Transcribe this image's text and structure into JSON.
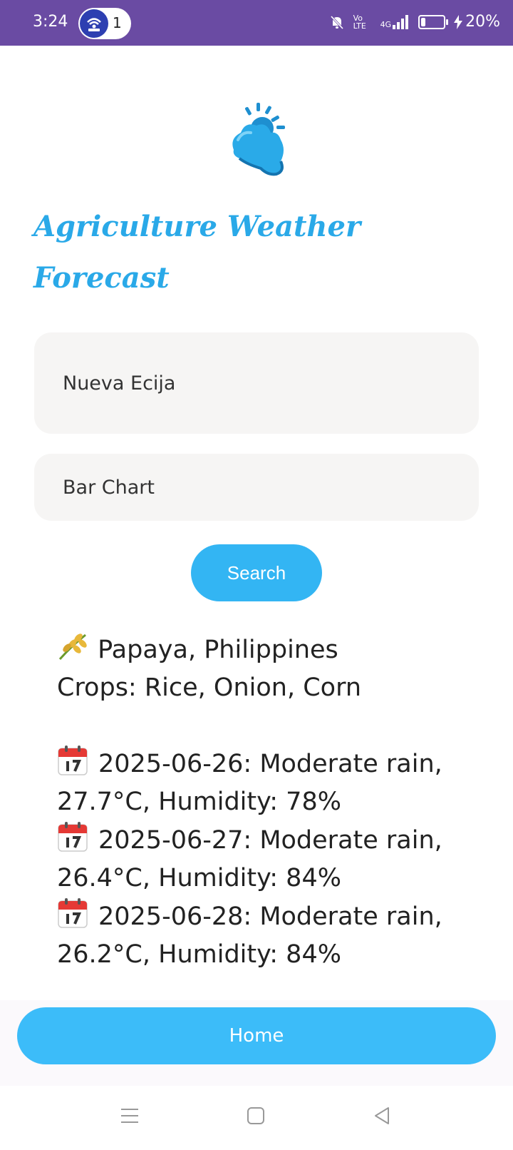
{
  "status_bar": {
    "time": "3:24",
    "notification_count": "1",
    "network_label": "Vo LTE",
    "signal_label": "4G",
    "battery_percent": "20%",
    "battery_level": 0.2,
    "background_color": "#6a4ba3"
  },
  "app": {
    "title": "Agriculture Weather Forecast",
    "accent_color": "#2aa9e8",
    "logo_icon": "cloud-sun-icon"
  },
  "form": {
    "location_value": "Nueva Ecija",
    "chart_type_value": "Bar Chart",
    "search_label": "Search"
  },
  "result": {
    "location_line": "Papaya, Philippines",
    "crops_line": "Crops: Rice, Onion, Corn",
    "forecasts": [
      {
        "line1": "2025-06-26: Moderate rain,",
        "line2": "27.7°C, Humidity: 78%"
      },
      {
        "line1": "2025-06-27: Moderate rain,",
        "line2": "26.4°C, Humidity: 84%"
      },
      {
        "line1": "2025-06-28: Moderate rain,",
        "line2": "26.2°C, Humidity: 84%"
      }
    ]
  },
  "footer": {
    "home_label": "Home"
  },
  "nav": {
    "items": [
      "menu-icon",
      "home-square-icon",
      "back-icon"
    ]
  }
}
